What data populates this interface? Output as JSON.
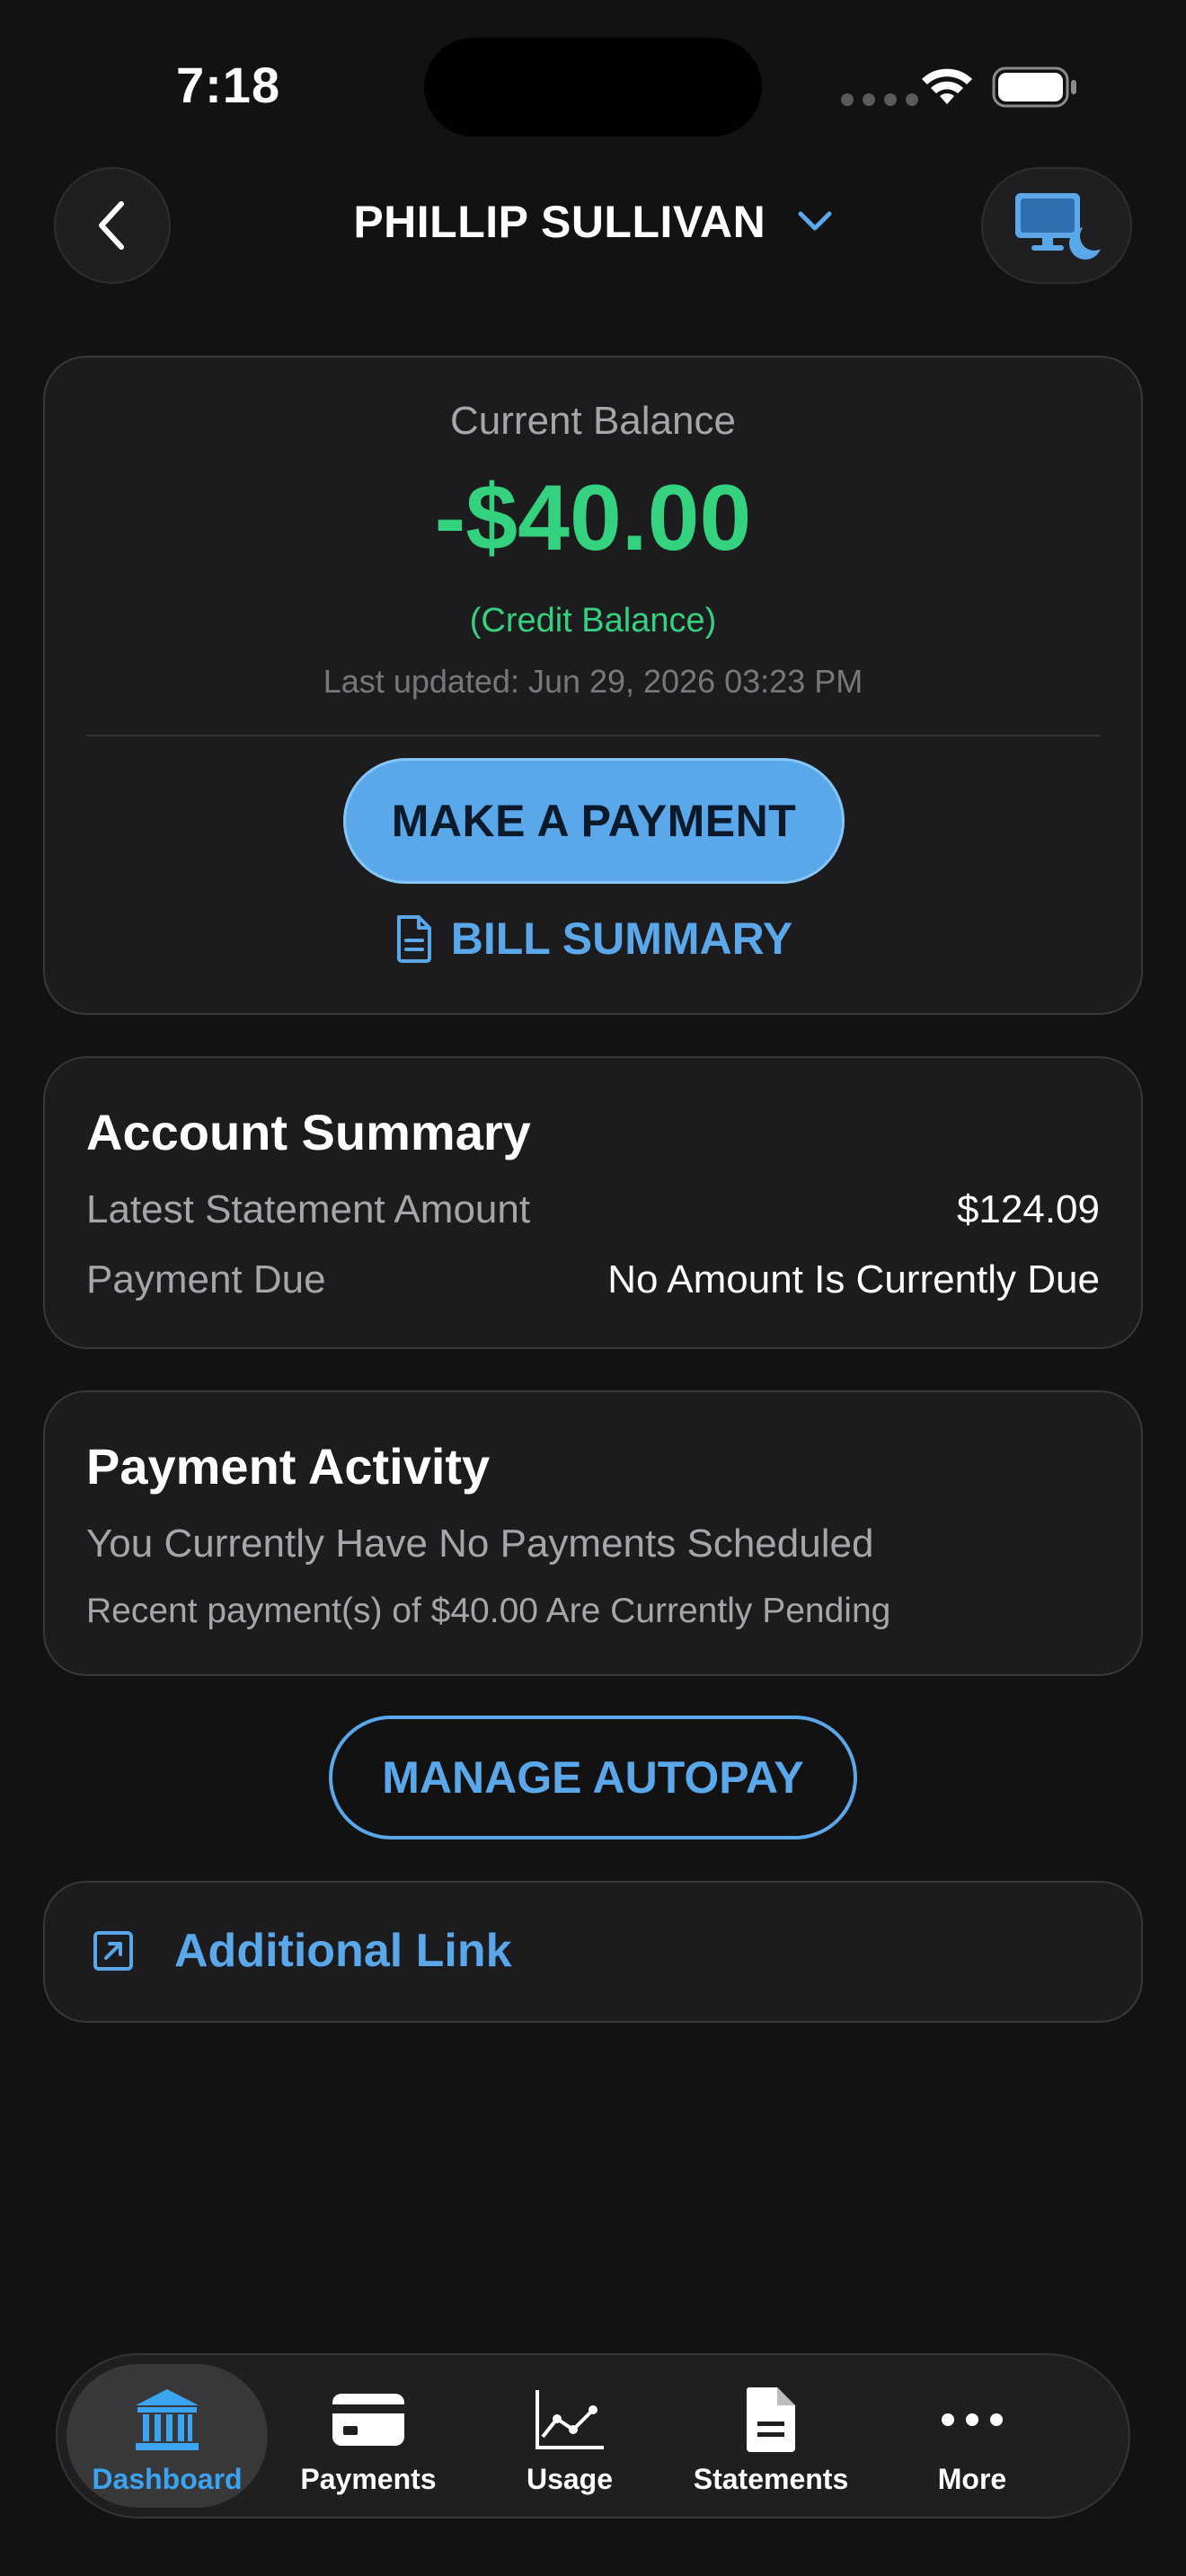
{
  "status_bar": {
    "time": "7:18"
  },
  "header": {
    "account_name": "PHILLIP SULLIVAN"
  },
  "balance_card": {
    "label": "Current Balance",
    "amount": "-$40.00",
    "credit_label": "(Credit Balance)",
    "last_updated": "Last updated: Jun 29, 2026 03:23 PM",
    "make_payment_label": "MAKE A PAYMENT",
    "bill_summary_label": "BILL SUMMARY"
  },
  "account_summary": {
    "title": "Account Summary",
    "rows": [
      {
        "label": "Latest Statement Amount",
        "value": "$124.09"
      },
      {
        "label": "Payment Due",
        "value": "No Amount Is Currently Due"
      }
    ]
  },
  "payment_activity": {
    "title": "Payment Activity",
    "line1": "You Currently Have No Payments Scheduled",
    "line2": "Recent payment(s) of $40.00 Are Currently Pending"
  },
  "autopay": {
    "label": "MANAGE AUTOPAY"
  },
  "additional_link": {
    "label": "Additional Link"
  },
  "tab_bar": {
    "tabs": [
      {
        "label": "Dashboard",
        "icon": "bank-icon",
        "active": true
      },
      {
        "label": "Payments",
        "icon": "credit-card-icon",
        "active": false
      },
      {
        "label": "Usage",
        "icon": "line-chart-icon",
        "active": false
      },
      {
        "label": "Statements",
        "icon": "document-icon",
        "active": false
      },
      {
        "label": "More",
        "icon": "more-dots-icon",
        "active": false
      }
    ]
  },
  "colors": {
    "accent_blue": "#5aa7ea",
    "credit_green": "#34d27f",
    "active_tab_blue": "#3aa4f0",
    "background": "#121212",
    "card": "#1c1c1e"
  }
}
